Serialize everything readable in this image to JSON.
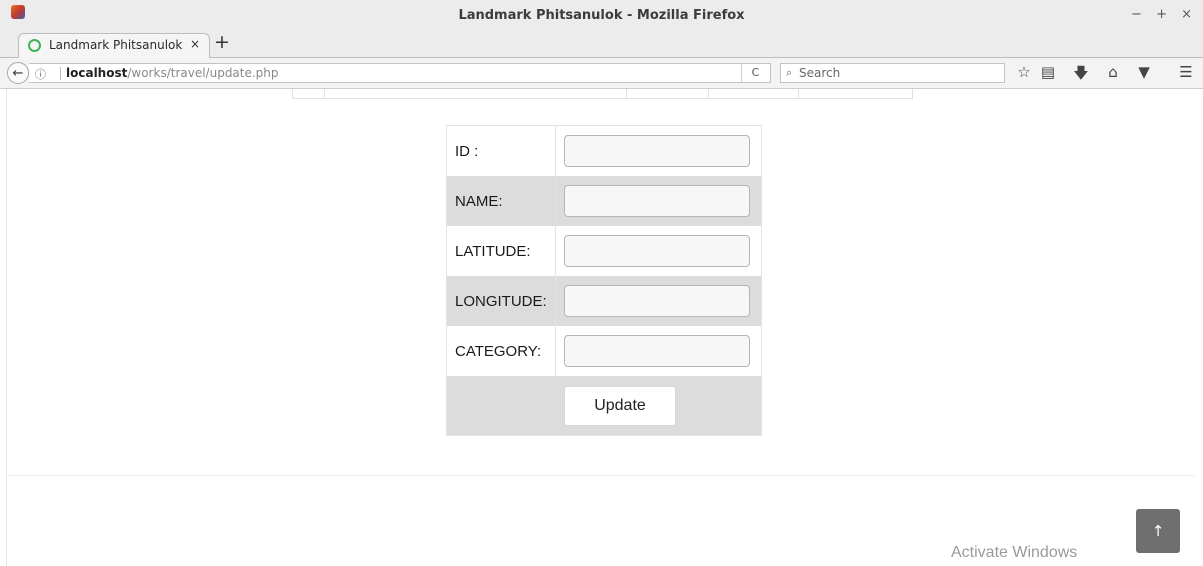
{
  "window": {
    "title": "Landmark Phitsanulok - Mozilla Firefox",
    "controls": "− + ×"
  },
  "tabs": [
    {
      "label": "Landmark Phitsanulok",
      "close": "×",
      "icon": "green-ring-favicon"
    }
  ],
  "newtab_label": "+",
  "navbar": {
    "back_icon": "←",
    "info_icon": "ⓘ",
    "url_host": "localhost",
    "url_path": "/works/travel/update.php",
    "reload_icon": "C",
    "search_icon": "🔍",
    "search_placeholder": "Search",
    "toolbar_icons": [
      "star-icon",
      "reading-list-icon",
      "download-icon",
      "home-icon",
      "pocket-icon",
      "menu-icon"
    ]
  },
  "form": {
    "fields": [
      {
        "label": "ID :",
        "value": ""
      },
      {
        "label": "NAME:",
        "value": ""
      },
      {
        "label": "LATITUDE:",
        "value": ""
      },
      {
        "label": "LONGITUDE:",
        "value": ""
      },
      {
        "label": "CATEGORY:",
        "value": ""
      }
    ],
    "submit_label": "Update"
  },
  "overlay": {
    "activate_windows": "Activate Windows",
    "back_to_top": "↑"
  }
}
